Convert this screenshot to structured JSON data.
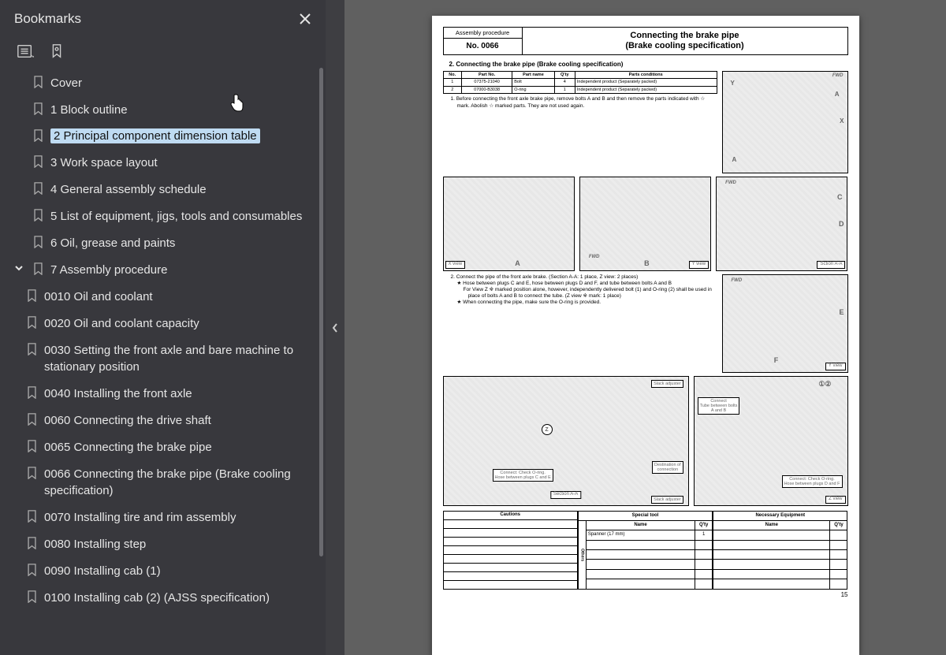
{
  "sidebar": {
    "title": "Bookmarks",
    "items": [
      {
        "label": "Cover"
      },
      {
        "label": "1 Block outline"
      },
      {
        "label": "2 Principal component dimension table",
        "selected": true
      },
      {
        "label": "3 Work space layout"
      },
      {
        "label": "4 General assembly schedule"
      },
      {
        "label": "5 List of equipment, jigs, tools and consumables"
      },
      {
        "label": "6 Oil, grease and paints"
      },
      {
        "label": "7 Assembly procedure",
        "expanded": true
      }
    ],
    "children": [
      {
        "label": "0010 Oil and coolant"
      },
      {
        "label": "0020 Oil and coolant capacity"
      },
      {
        "label": "0030 Setting the front axle and bare machine to stationary position"
      },
      {
        "label": "0040 Installing the front axle"
      },
      {
        "label": "0060 Connecting the drive shaft"
      },
      {
        "label": "0065 Connecting the brake pipe"
      },
      {
        "label": "0066 Connecting the brake pipe (Brake cooling specification)"
      },
      {
        "label": "0070 Installing tire and rim assembly"
      },
      {
        "label": "0080 Installing step"
      },
      {
        "label": "0090 Installing cab (1)"
      },
      {
        "label": "0100 Installing cab (2) (AJSS specification)"
      }
    ]
  },
  "doc": {
    "header": {
      "left_top": "Assembly procedure",
      "left_bot": "No. 0066",
      "title_line1": "Connecting the brake pipe",
      "title_line2": "(Brake cooling specification)"
    },
    "section2_title": "2.  Connecting the brake pipe (Brake cooling specification)",
    "parts_headers": {
      "no": "No.",
      "partno": "Part No.",
      "name": "Part name",
      "qty": "Q'ty",
      "cond": "Parts conditions"
    },
    "parts": [
      {
        "no": "1",
        "partno": "07375-21040",
        "name": "Bolt",
        "qty": "4",
        "cond": "Independent product (Separately packed)"
      },
      {
        "no": "2",
        "partno": "07000-B3038",
        "name": "O-ring",
        "qty": "1",
        "cond": "Independent product (Separately packed)"
      }
    ],
    "note1": "1.  Before connecting the front axle brake pipe, remove bolts A and B and then remove the parts indicated with ☆ mark. Abolish ☆ marked parts.  They are not used again.",
    "note2": "2.  Connect the pipe of the front axle brake. (Section A-A: 1 place, Z view: 2 places)",
    "star_a": "★  Hose between plugs C and E, hose between plugs D and F, and tube between bolts A and B",
    "star_b": "For View Z ※ marked position alone, however, independently delivered bolt (1) and O-ring (2) shall be used in place of bolts A and B to connect the tube. (Z view ※ mark: 1 place)",
    "star_c": "★  When connecting the pipe, make sure the O-ring is provided.",
    "labels": {
      "fwd": "FWD",
      "a": "A",
      "b": "B",
      "c": "C",
      "d": "D",
      "e": "E",
      "f": "F",
      "x": "X",
      "y": "Y",
      "z": "Z",
      "xview": "X view",
      "yview": "Y view",
      "zview": "Z view",
      "sectionAA": "Section A-A",
      "sctionAA": "Sction A-A",
      "slack": "Slack adjuster",
      "connect_btwn": "Connect\nTube between bolts\nA and B",
      "connect_ce": "Connect: Check O-ring.\nHose between plugs C and E",
      "connect_df": "Connect: Check O-ring.\nHose between plugs D and F",
      "dest": "Destination of\nconnection",
      "circled12": "①②"
    },
    "bottom": {
      "cautions": "Cautions",
      "special": "Special tool",
      "necessary": "Necessary Equipment",
      "name": "Name",
      "qty": "Q'ty",
      "spanner": "Spanner (17 mm)",
      "spanner_qty": "1",
      "others": "Others"
    },
    "page_num": "15"
  }
}
